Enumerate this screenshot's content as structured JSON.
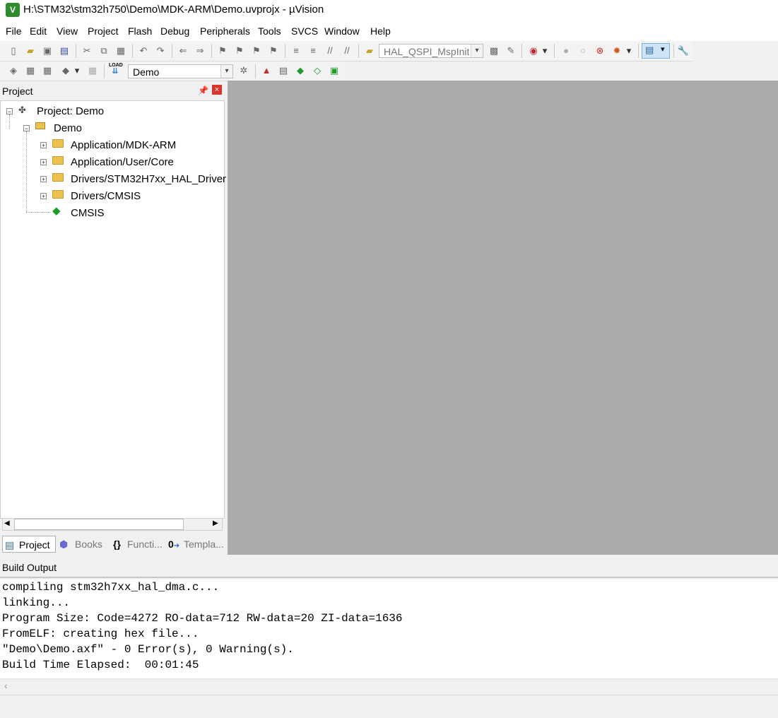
{
  "window": {
    "title": "H:\\STM32\\stm32h750\\Demo\\MDK-ARM\\Demo.uvprojx - µVision",
    "app_icon": "V"
  },
  "menu": [
    "File",
    "Edit",
    "View",
    "Project",
    "Flash",
    "Debug",
    "Peripherals",
    "Tools",
    "SVCS",
    "Window",
    "Help"
  ],
  "toolbar": {
    "function_combo": "HAL_QSPI_MspInit",
    "target_combo": "Demo",
    "load_label": "LOAD"
  },
  "project_panel": {
    "title": "Project",
    "tree": {
      "root": "Project: Demo",
      "target": "Demo",
      "groups": [
        "Application/MDK-ARM",
        "Application/User/Core",
        "Drivers/STM32H7xx_HAL_Driver",
        "Drivers/CMSIS"
      ],
      "component": "CMSIS"
    },
    "tabs": [
      "Project",
      "Books",
      "Functi...",
      "Templa..."
    ]
  },
  "build_output": {
    "title": "Build Output",
    "lines": [
      "compiling stm32h7xx_hal_dma.c...",
      "linking...",
      "Program Size: Code=4272 RO-data=712 RW-data=20 ZI-data=1636",
      "FromELF: creating hex file...",
      "\"Demo\\Demo.axf\" - 0 Error(s), 0 Warning(s).",
      "Build Time Elapsed:  00:01:45"
    ]
  }
}
